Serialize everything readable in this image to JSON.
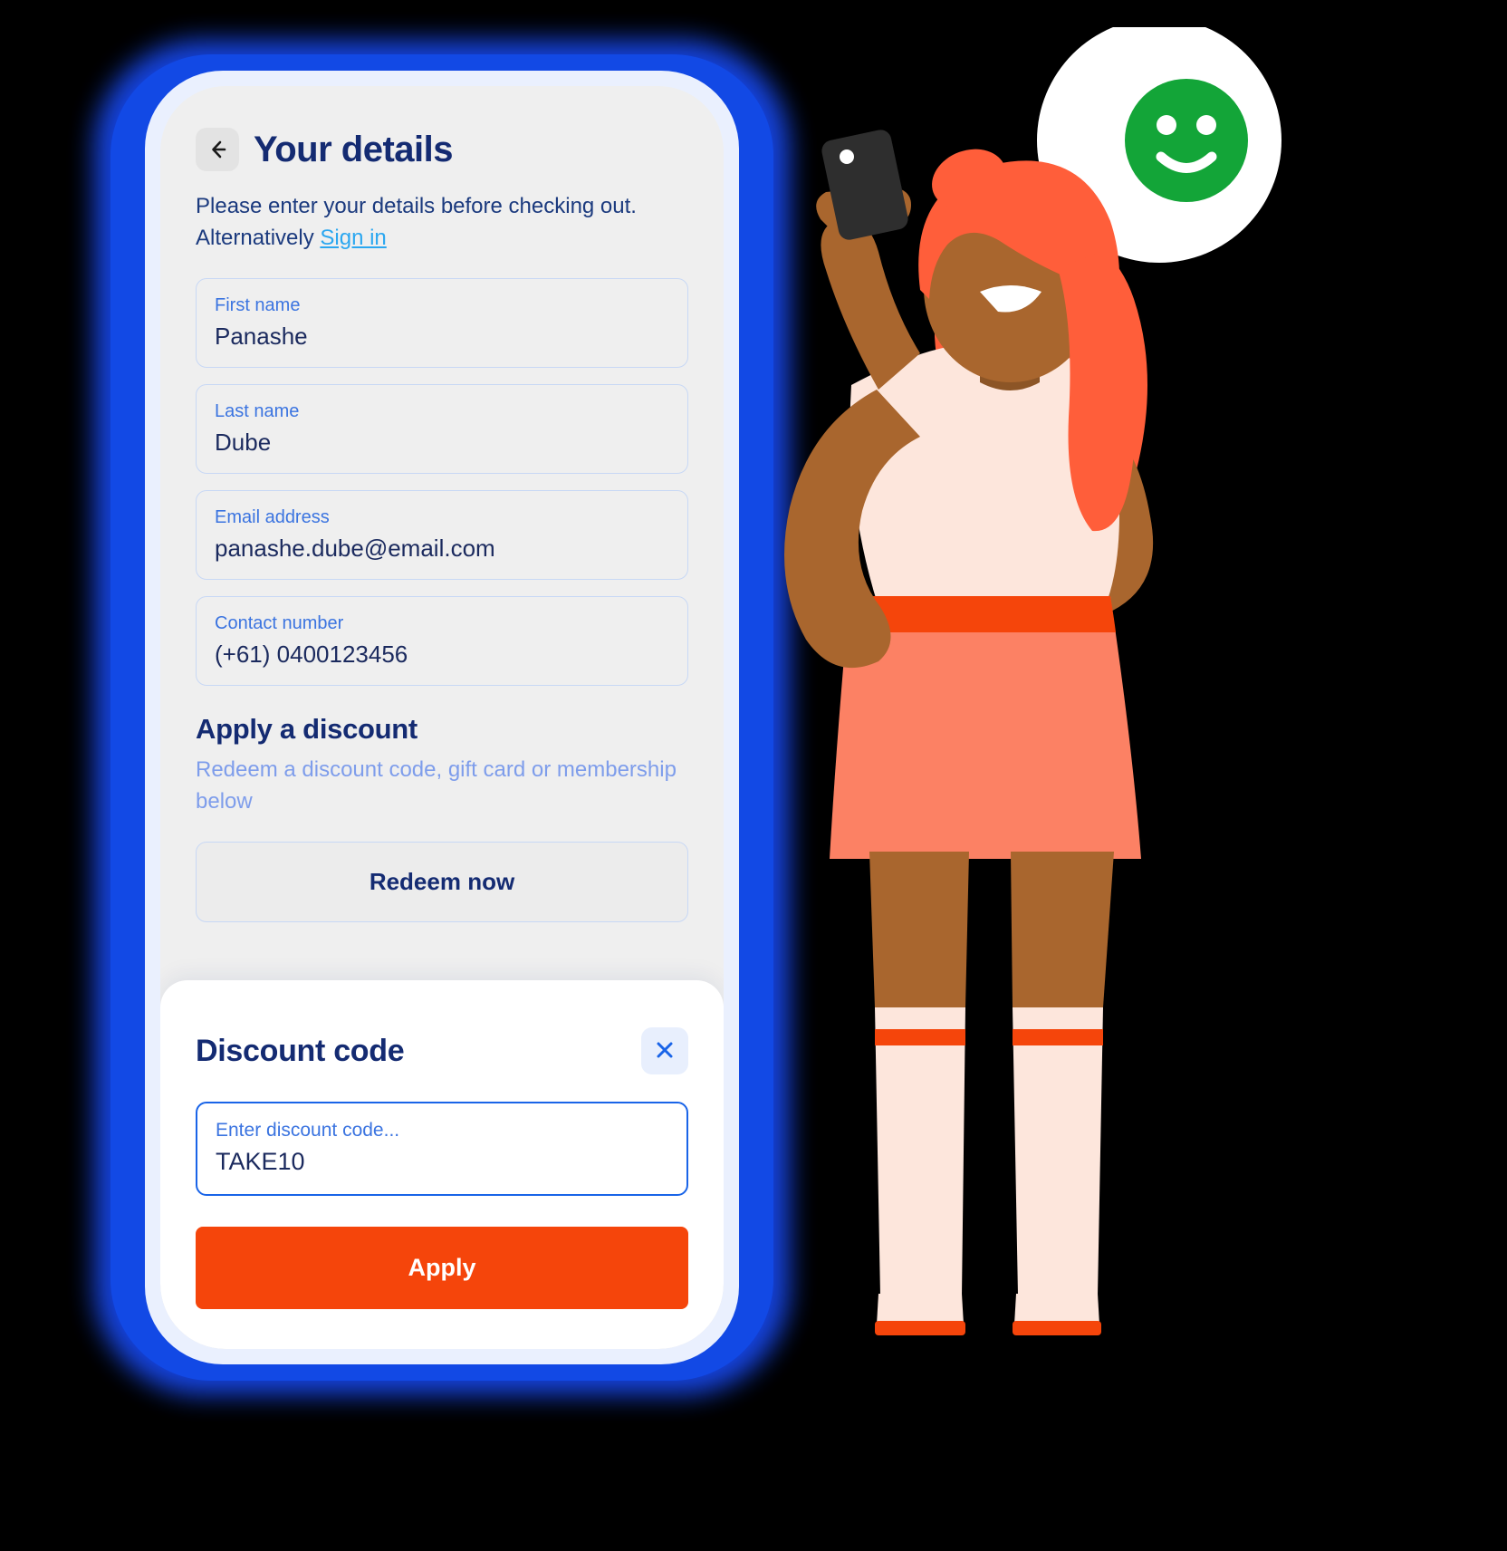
{
  "screen": {
    "title": "Your details",
    "back_icon": "arrow-left-icon",
    "intro_text": "Please enter your details before checking out. Alternatively ",
    "signin_link": "Sign in",
    "fields": [
      {
        "label": "First name",
        "value": "Panashe"
      },
      {
        "label": "Last name",
        "value": "Dube"
      },
      {
        "label": "Email address",
        "value": "panashe.dube@email.com"
      },
      {
        "label": "Contact number",
        "value": "(+61) 0400123456"
      }
    ],
    "discount_section": {
      "title": "Apply a discount",
      "subtitle": "Redeem a discount code, gift card or membership below",
      "redeem_button": "Redeem now"
    }
  },
  "sheet": {
    "title": "Discount code",
    "close_icon": "close-icon",
    "input_placeholder": "Enter discount code...",
    "input_value": "TAKE10",
    "apply_button": "Apply"
  },
  "illustration": {
    "bubble_icon": "thought-bubble",
    "face_icon": "smiley-face-icon",
    "phone_icon": "mobile-phone-icon"
  },
  "colors": {
    "frame_blue": "#1249E5",
    "accent_orange": "#F5450B",
    "title_navy": "#142B72",
    "link_blue": "#2BA7F0",
    "label_blue": "#3B74E0",
    "muted_blue": "#7E9DEB",
    "smiley_green": "#13A538"
  }
}
